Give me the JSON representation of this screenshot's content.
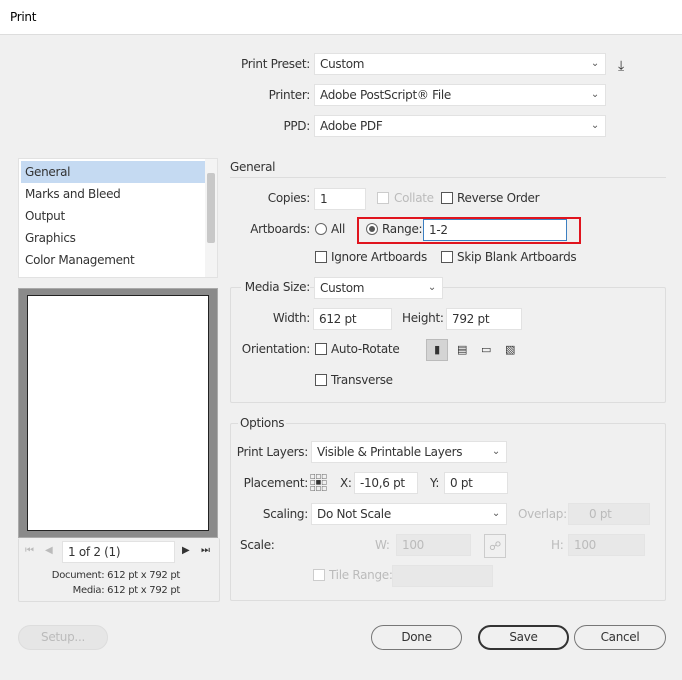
{
  "window": {
    "title": "Print"
  },
  "top": {
    "preset_label": "Print Preset:",
    "preset_value": "Custom",
    "printer_label": "Printer:",
    "printer_value": "Adobe PostScript® File",
    "ppd_label": "PPD:",
    "ppd_value": "Adobe PDF"
  },
  "sidebar": {
    "items": [
      {
        "label": "General"
      },
      {
        "label": "Marks and Bleed"
      },
      {
        "label": "Output"
      },
      {
        "label": "Graphics"
      },
      {
        "label": "Color Management"
      }
    ]
  },
  "preview": {
    "page_field": "1 of 2 (1)",
    "document": "Document: 612 pt x 792 pt",
    "media": "Media: 612 pt x 792 pt"
  },
  "general": {
    "heading": "General",
    "copies_label": "Copies:",
    "copies_value": "1",
    "collate_label": "Collate",
    "reverse_label": "Reverse Order",
    "artboards_label": "Artboards:",
    "all_label": "All",
    "range_label": "Range:",
    "range_value": "1-2",
    "ignore_label": "Ignore Artboards",
    "skip_label": "Skip Blank Artboards",
    "media_size_label": "Media Size:",
    "media_size_value": "Custom",
    "width_label": "Width:",
    "width_value": "612 pt",
    "height_label": "Height:",
    "height_value": "792 pt",
    "orientation_label": "Orientation:",
    "autorotate_label": "Auto-Rotate",
    "transverse_label": "Transverse"
  },
  "options": {
    "heading": "Options",
    "layers_label": "Print Layers:",
    "layers_value": "Visible & Printable Layers",
    "placement_label": "Placement:",
    "x_label": "X:",
    "x_value": "-10,6 pt",
    "y_label": "Y:",
    "y_value": "0 pt",
    "scaling_label": "Scaling:",
    "scaling_value": "Do Not Scale",
    "overlap_label": "Overlap:",
    "overlap_value": "0 pt",
    "scale_label": "Scale:",
    "w_label": "W:",
    "w_value": "100",
    "h_label": "H:",
    "h_value": "100",
    "tile_label": "Tile Range:"
  },
  "buttons": {
    "setup": "Setup...",
    "done": "Done",
    "save": "Save",
    "cancel": "Cancel"
  },
  "colors": {
    "highlight": "#e0141e",
    "selection": "#c5daf2"
  }
}
